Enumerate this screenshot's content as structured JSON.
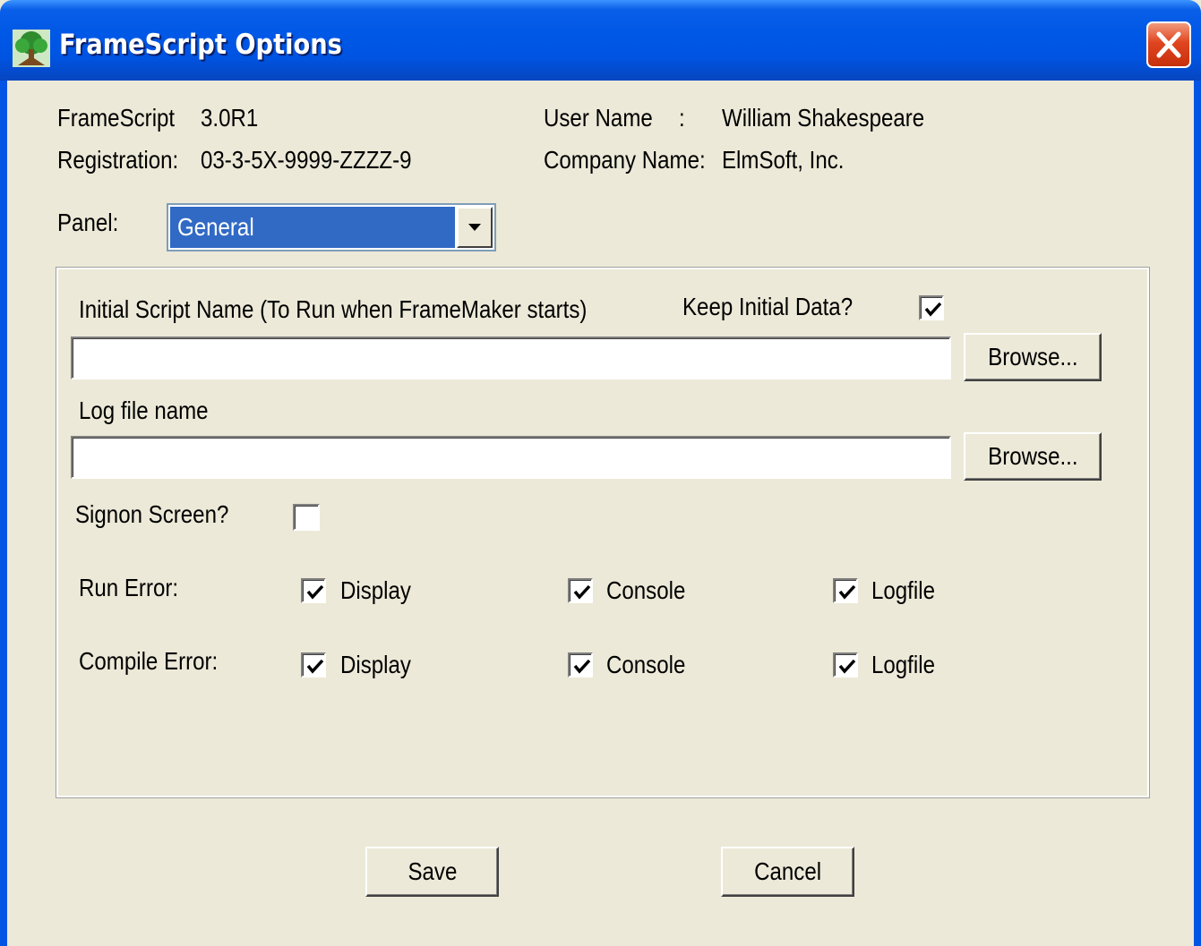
{
  "window": {
    "title": "FrameScript Options",
    "icon": "tree-icon",
    "close_icon": "close-icon"
  },
  "info": {
    "product_label": "FrameScript",
    "product_version": "3.0R1",
    "registration_label": "Registration:",
    "registration_value": "03-3-5X-9999-ZZZZ-9",
    "user_label": "User Name",
    "user_sep": ":",
    "user_value": "William Shakespeare",
    "company_label": "Company Name:",
    "company_value": "ElmSoft, Inc."
  },
  "panel": {
    "label": "Panel:",
    "selected": "General",
    "dropdown_icon": "chevron-down-icon"
  },
  "general": {
    "initial_script_label": "Initial Script Name (To Run when FrameMaker starts)",
    "initial_script_value": "",
    "keep_initial_label": "Keep Initial Data?",
    "keep_initial_checked": true,
    "browse1_label": "Browse...",
    "log_file_label": "Log file name",
    "log_file_value": "",
    "browse2_label": "Browse...",
    "signon_label": "Signon Screen?",
    "signon_checked": false
  },
  "errors": {
    "run_label": "Run Error:",
    "compile_label": "Compile Error:",
    "display_label": "Display",
    "console_label": "Console",
    "logfile_label": "Logfile",
    "run_display": true,
    "run_console": true,
    "run_logfile": true,
    "compile_display": true,
    "compile_console": true,
    "compile_logfile": true
  },
  "buttons": {
    "save": "Save",
    "cancel": "Cancel"
  },
  "colors": {
    "titlebar": "#0054e3",
    "dialog_bg": "#ece9d8",
    "selection": "#316ac5",
    "close": "#e0451f"
  }
}
